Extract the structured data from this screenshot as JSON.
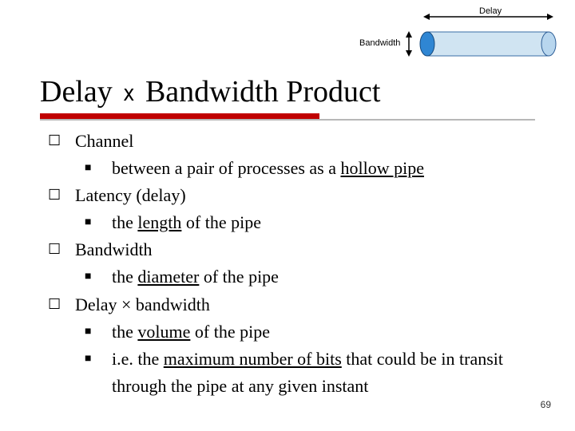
{
  "diagram": {
    "delay_label": "Delay",
    "bandwidth_label": "Bandwidth"
  },
  "title": {
    "left": "Delay",
    "mult": "ⅹ",
    "right": "Bandwidth Product"
  },
  "items": [
    {
      "label": "Channel",
      "subs": [
        {
          "pre": "between a pair of processes as a ",
          "u": "hollow pipe",
          "post": ""
        }
      ]
    },
    {
      "label": "Latency (delay)",
      "subs": [
        {
          "pre": "the ",
          "u": "length",
          "post": " of the pipe"
        }
      ]
    },
    {
      "label": "Bandwidth",
      "subs": [
        {
          "pre": "the ",
          "u": "diameter",
          "post": " of the pipe"
        }
      ]
    },
    {
      "label": "Delay × bandwidth",
      "subs": [
        {
          "pre": "the ",
          "u": "volume",
          "post": " of the pipe"
        },
        {
          "pre": "i.e. the ",
          "u": "maximum number of bits",
          "post": " that could be in transit through the pipe at any given instant"
        }
      ]
    }
  ],
  "page_number": "69"
}
